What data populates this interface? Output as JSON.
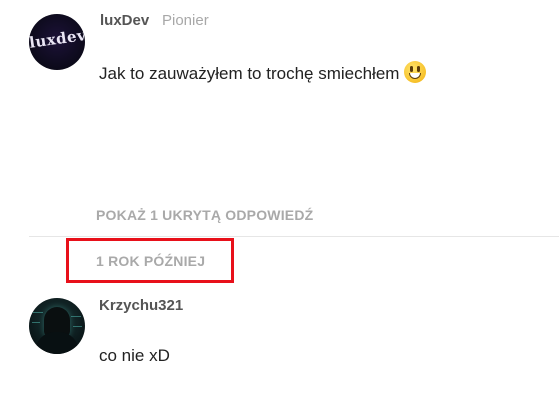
{
  "comments": [
    {
      "username": "luxDev",
      "rank": "Pionier",
      "avatar_text": "luxdev",
      "text": "Jak to zauważyłem to trochę smiechłem",
      "emoji": "grinning-face-emoji"
    },
    {
      "username": "Krzychu321",
      "avatar": "hooded-hacker-avatar",
      "text": "co nie xD"
    }
  ],
  "show_hidden_replies_label": "POKAŻ 1 UKRYTĄ ODPOWIEDŹ",
  "time_gap_label": "1 ROK PÓŹNIEJ",
  "colors": {
    "highlight": "#e8101a",
    "muted": "#a9a9a9",
    "username": "#555555",
    "text": "#222222"
  }
}
